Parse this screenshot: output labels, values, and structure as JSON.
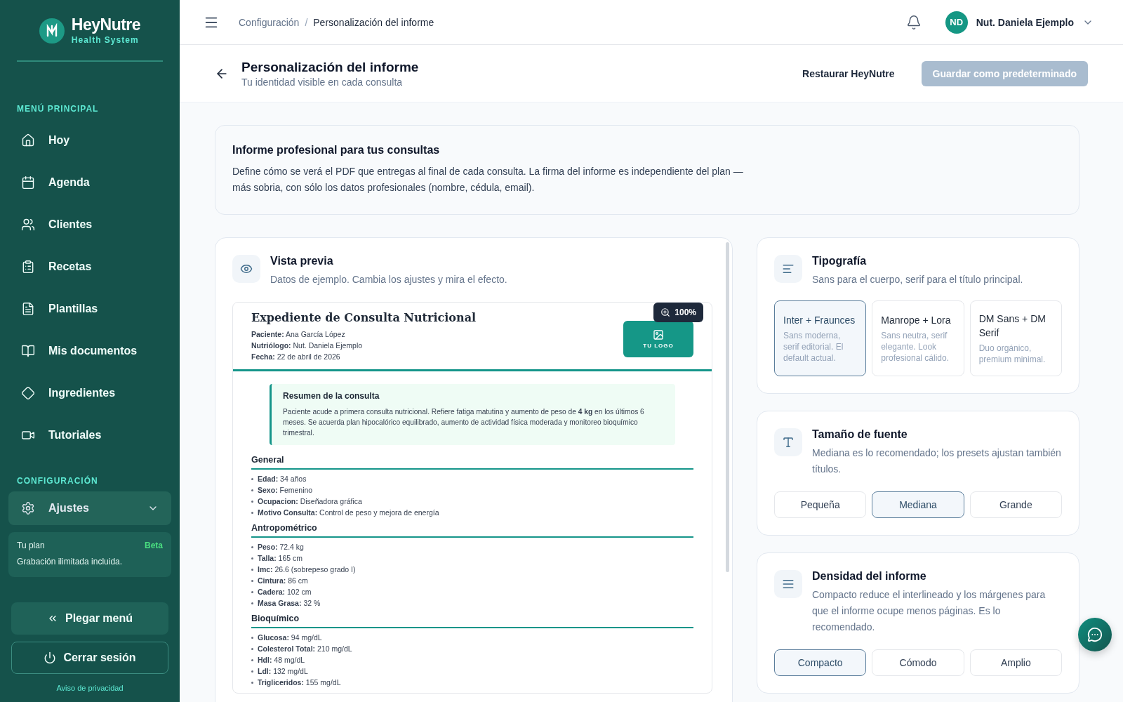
{
  "brand": {
    "name": "HeyNutre",
    "tagline": "Health System"
  },
  "sidebar": {
    "sections": [
      {
        "title": "MENÚ PRINCIPAL",
        "items": [
          {
            "label": "Hoy"
          },
          {
            "label": "Agenda"
          },
          {
            "label": "Clientes"
          },
          {
            "label": "Recetas"
          },
          {
            "label": "Plantillas"
          },
          {
            "label": "Mis documentos"
          },
          {
            "label": "Ingredientes"
          },
          {
            "label": "Tutoriales"
          }
        ]
      },
      {
        "title": "CONFIGURACIÓN",
        "items": [
          {
            "label": "Ajustes",
            "expanded": false
          }
        ]
      }
    ],
    "plan": {
      "title": "Tu plan",
      "badge": "Beta",
      "text": "Grabación ilimitada incluida."
    },
    "collapse_button": "Plegar menú",
    "logout_button": "Cerrar sesión",
    "privacy_link": "Aviso de privacidad"
  },
  "topbar": {
    "separator": "/",
    "breadcrumb": [
      "Configuración",
      "Personalización del informe"
    ],
    "user": {
      "initials": "ND",
      "name": "Nut. Daniela Ejemplo"
    }
  },
  "header": {
    "title": "Personalización del informe",
    "subtitle": "Tu identidad visible en cada consulta",
    "restore_button": "Restaurar HeyNutre",
    "save_button": {
      "label": "Guardar como predeterminado",
      "disabled": true
    }
  },
  "intro": {
    "title": "Informe profesional para tus consultas",
    "text": "Define cómo se verá el PDF que entregas al final de cada consulta. La firma del informe es independiente del plan — más sobria, con sólo los datos profesionales (nombre, cédula, email)."
  },
  "preview": {
    "title": "Vista previa",
    "subtitle": "Datos de ejemplo. Cambia los ajustes y mira el efecto.",
    "zoom": "100%",
    "document": {
      "title": "Expediente de Consulta Nutricional",
      "meta": [
        {
          "label": "Paciente:",
          "value": "Ana García López"
        },
        {
          "label": "Nutriólogo:",
          "value": "Nut. Daniela Ejemplo"
        },
        {
          "label": "Fecha:",
          "value": "22 de abril de 2026"
        }
      ],
      "logo": "TU LOGO",
      "summary": {
        "title": "Resumen de la consulta",
        "text": "Paciente acude a primera consulta nutricional. Refiere fatiga matutina y aumento de peso de **4 kg** en los últimos 6 meses. Se acuerda plan hipocalórico equilibrado, aumento de actividad física moderada y monitoreo bioquímico trimestral."
      },
      "sections": [
        {
          "title": "General",
          "items": [
            {
              "label": "Edad:",
              "value": "34 años"
            },
            {
              "label": "Sexo:",
              "value": "Femenino"
            },
            {
              "label": "Ocupacion:",
              "value": "Diseñadora gráfica"
            },
            {
              "label": "Motivo Consulta:",
              "value": "Control de peso y mejora de energía"
            }
          ]
        },
        {
          "title": "Antropométrico",
          "items": [
            {
              "label": "Peso:",
              "value": "72.4 kg"
            },
            {
              "label": "Talla:",
              "value": "165 cm"
            },
            {
              "label": "Imc:",
              "value": "26.6 (sobrepeso grado I)"
            },
            {
              "label": "Cintura:",
              "value": "86 cm"
            },
            {
              "label": "Cadera:",
              "value": "102 cm"
            },
            {
              "label": "Masa Grasa:",
              "value": "32 %"
            }
          ]
        },
        {
          "title": "Bioquímico",
          "items": [
            {
              "label": "Glucosa:",
              "value": "94 mg/dL"
            },
            {
              "label": "Colesterol Total:",
              "value": "210 mg/dL"
            },
            {
              "label": "Hdl:",
              "value": "48 mg/dL"
            },
            {
              "label": "Ldl:",
              "value": "132 mg/dL"
            },
            {
              "label": "Trigliceridos:",
              "value": "155 mg/dL"
            }
          ]
        }
      ]
    }
  },
  "settings": [
    {
      "kind": "cards",
      "title": "Tipografía",
      "subtitle": "Sans para el cuerpo, serif para el título principal.",
      "options": [
        {
          "label": "Inter + Fraunces",
          "description": "Sans moderna, serif editorial. El default actual.",
          "selected": true
        },
        {
          "label": "Manrope + Lora",
          "description": "Sans neutra, serif elegante. Look profesional cálido.",
          "selected": false
        },
        {
          "label": "DM Sans + DM Serif",
          "description": "Duo orgánico, premium minimal.",
          "selected": false
        }
      ]
    },
    {
      "kind": "size",
      "title": "Tamaño de fuente",
      "subtitle": "Mediana es lo recomendado; los presets ajustan también títulos.",
      "options": [
        {
          "label": "Pequeña",
          "selected": false
        },
        {
          "label": "Mediana",
          "selected": true
        },
        {
          "label": "Grande",
          "selected": false
        }
      ]
    },
    {
      "kind": "density",
      "title": "Densidad del informe",
      "subtitle": "Compacto reduce el interlineado y los márgenes para que el informe ocupe menos páginas. Es lo recomendado.",
      "options": [
        {
          "label": "Compacto",
          "selected": true
        },
        {
          "label": "Cómodo",
          "selected": false
        },
        {
          "label": "Amplio",
          "selected": false
        }
      ]
    }
  ]
}
